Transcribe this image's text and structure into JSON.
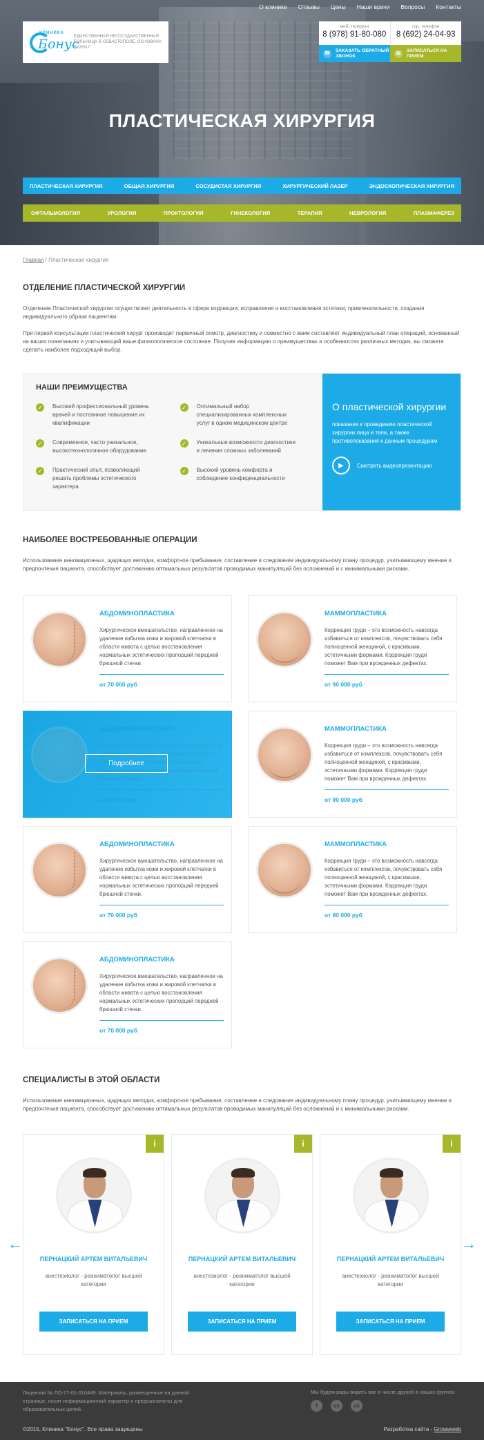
{
  "top_nav": [
    "О клинике",
    "Отзывы",
    "Цены",
    "Наши врачи",
    "Вопросы",
    "Контакты"
  ],
  "logo": {
    "small": "КЛИНИКА",
    "big": "Бонус",
    "tagline": "Единственная негосударственная больница в Севастополе. Основана в 1993 г."
  },
  "phones": {
    "mobile_label": "моб. телефон",
    "mobile": "8 (978) 91-80-080",
    "city_label": "гор. телефон",
    "city": "8 (692) 24-04-93",
    "callback": "Заказать обратный звонок",
    "appointment": "Записаться на прием"
  },
  "hero_title": "ПЛАСТИЧЕСКАЯ ХИРУРГИЯ",
  "menu_blue": [
    "Пластическая хирургия",
    "Общая хирургия",
    "Сосудистая хирургия",
    "Хирургический лазер",
    "Эндоскопическая хирургия"
  ],
  "menu_green": [
    "Офтальмология",
    "Урология",
    "Проктология",
    "Гинекология",
    "Терапия",
    "Неврология",
    "Плазмаферез"
  ],
  "breadcrumb": {
    "home": "Главная",
    "sep": " / ",
    "current": "Пластическая хирургия"
  },
  "department": {
    "title": "ОТДЕЛЕНИЕ ПЛАСТИЧЕСКОЙ ХИРУРГИИ",
    "p1": "Отделение Пластической хирургии осуществляет деятельность в сфере коррекции, исправления и восстановления эстетики, привлекательности, создания индивидуального образа пациентам.",
    "p2": "При первой консультации пластический хирург производит первичный осмотр, диагностику и совместно с вами составляет индивидуальный план операций, основанный на ваших пожеланиях и учитывающий ваше физиологическое состояние. Получив информацию о преимуществах и особенностях различных методик, вы сможете сделать наиболее подходящий выбор."
  },
  "advantages": {
    "title": "НАШИ ПРЕИМУЩЕСТВА",
    "items": [
      "Высокий профессиональный уровень врачей и постоянное повышение их квалификации",
      "Оптимальный набор специализированных комплексных услуг в одном медицинском центре",
      "Современное, часто уникальное, высокотехнологичное оборудование",
      "Уникальные возможности диагностики и лечения сложных заболеваний",
      "Практический опыт, позволяющий решать проблемы эстетического характера",
      "Высокий уровень комфорта и соблюдение конфиденциальности"
    ],
    "about_title": "О пластической хирургии",
    "about_text": "показания к проведению пластической хирургии лица и тела, а также противопоказания к данным процедурам",
    "video": "Смотреть видеопрезентацию"
  },
  "operations": {
    "title": "НАИБОЛЕЕ ВОСТРЕБОВАННЫЕ ОПЕРАЦИИ",
    "intro": "Использование инновационных, щадящих методик, комфортное пребывание, составление и следование индивидуальному плану процедур, учитывающему мнение и предпочтения пациента, способствует достижению оптимальных результатов проводимых манипуляций без осложнений и с минимальными рисками.",
    "more": "Подробнее",
    "items": [
      {
        "title": "АБДОМИНОПЛАСТИКА",
        "desc": "Хирургическое вмешательство, направленное на удаление избытка кожи и жировой клетчатки в области живота с целью восстановления нормальных эстетических пропорций передней брюшной стенки.",
        "price": "от 70 000 руб"
      },
      {
        "title": "МАММОПЛАСТИКА",
        "desc": "Коррекция груди – это возможность навсегда избавиться от комплексов, почувствовать себя полноценной женщиной, с красивыми, эстетичными формами. Коррекция груди поможет Вам при врожденных дефектах.",
        "price": "от 90 000 руб"
      },
      {
        "title": "АБДОМИНОПЛАСТИКА",
        "desc": "Хирургическое вмешательство, направленное на удаление избытка кожи и жировой клетчатки в области живота с целью восстановления нормальных эстетических пропорций передней брюшной стенки.",
        "price": "от 70 000 руб"
      },
      {
        "title": "МАММОПЛАСТИКА",
        "desc": "Коррекция груди – это возможность навсегда избавиться от комплексов, почувствовать себя полноценной женщиной, с красивыми, эстетичными формами. Коррекция груди поможет Вам при врожденных дефектах.",
        "price": "от 90 000 руб"
      },
      {
        "title": "АБДОМИНОПЛАСТИКА",
        "desc": "Хирургическое вмешательство, направленное на удаление избытка кожи и жировой клетчатки в области живота с целью восстановления нормальных эстетических пропорций передней брюшной стенки.",
        "price": "от 70 000 руб"
      },
      {
        "title": "МАММОПЛАСТИКА",
        "desc": "Коррекция груди – это возможность навсегда избавиться от комплексов, почувствовать себя полноценной женщиной, с красивыми, эстетичными формами. Коррекция груди поможет Вам при врожденных дефектах.",
        "price": "от 90 000 руб"
      },
      {
        "title": "АБДОМИНОПЛАСТИКА",
        "desc": "Хирургическое вмешательство, направленное на удаление избытка кожи и жировой клетчатки в области живота с целью восстановления нормальных эстетических пропорций передней брюшной стенки.",
        "price": "от 70 000 руб"
      }
    ]
  },
  "specialists": {
    "title": "СПЕЦИАЛИСТЫ В ЭТОЙ ОБЛАСТИ",
    "intro": "Использование инновационных, щадящих методик, комфортное пребывание, составление и следование индивидуальному плану процедур, учитывающему мнение и предпочтения пациента, способствует достижению оптимальных результатов проводимых манипуляций без осложнений и с минимальными рисками.",
    "info": "i",
    "button": "ЗАПИСАТЬСЯ НА ПРИЕМ",
    "doctors": [
      {
        "name": "ПЕРНАЦКИЙ АРТЕМ ВИТАЛЬЕВИЧ",
        "role": "анестезиолог - реаниматолог высшей категории"
      },
      {
        "name": "ПЕРНАЦКИЙ АРТЕМ ВИТАЛЬЕВИЧ",
        "role": "анестезиолог - реаниматолог высшей категории"
      },
      {
        "name": "ПЕРНАЦКИЙ АРТЕМ ВИТАЛЬЕВИЧ",
        "role": "анестезиолог - реаниматолог высшей категории"
      }
    ]
  },
  "footer": {
    "license": "Лицензия № ЛО-77-01-010449. Материалы, размещенные на данной странице, носят информационный характер и предназначены для образовательных целей.",
    "social_text": "Мы будем рады видеть вас в числе друзей в наших группах",
    "copyright": "©2015, Клиника \"Бонус\". Все права защищены",
    "dev_text": "Разработка сайта - ",
    "dev_link": "Growwweb"
  },
  "colors": {
    "accent_blue": "#1cabe6",
    "accent_green": "#a6b82a",
    "footer_bg": "#3b3b3b"
  }
}
